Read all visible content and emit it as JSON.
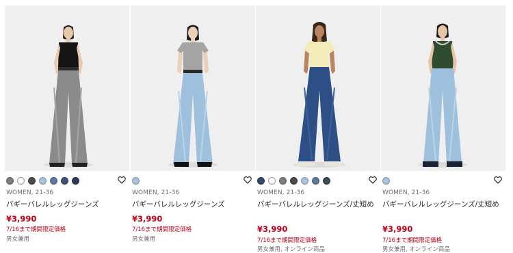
{
  "products": [
    {
      "image_alt": "model wearing grey baggy barrel leg jeans with black tank top",
      "colors": [
        "#7d7d7d",
        "#ffffff",
        "#4a4a4a",
        "#a9c3df",
        "#5c78a0",
        "#3d5275",
        "#2c3a55"
      ],
      "meta": "WOMEN, 21-36",
      "name": "バギーバレルレッグジーンズ",
      "price": "¥3,990",
      "promo": "7/16まで期間限定価格",
      "note": "男女兼用"
    },
    {
      "image_alt": "model wearing light blue baggy barrel leg jeans with grey t-shirt",
      "colors": [
        "#a9c3df"
      ],
      "meta": "WOMEN, 21-36",
      "name": "バギーバレルレッグジーンズ",
      "price": "¥3,990",
      "promo": "7/16まで期間限定価格",
      "note": "男女兼用"
    },
    {
      "image_alt": "model wearing dark blue baggy barrel leg jeans with pale yellow top",
      "colors": [
        "#34466a",
        "#ffffff",
        "#7d7d7d",
        "#4a4a4a",
        "#a9c3df",
        "#5c78a0",
        "#3a4e58"
      ],
      "meta": "WOMEN, 21-36",
      "name": "バギーバレルレッグジーンズ/丈短め",
      "price": "¥3,990",
      "promo": "7/16まで期間限定価格",
      "note": "男女兼用, オンライン商品"
    },
    {
      "image_alt": "model wearing light blue baggy barrel leg jeans with green tank top",
      "colors": [
        "#a9c3df"
      ],
      "meta": "WOMEN, 21-36",
      "name": "バギーバレルレッグジーンズ/丈短め",
      "price": "¥3,990",
      "promo": "7/16まで期間限定価格",
      "note": "男女兼用, オンライン商品"
    }
  ],
  "favorite_icon": "heart-outline-icon",
  "theme": {
    "price_color": "#c10019",
    "muted_text": "#6b6b6b"
  }
}
